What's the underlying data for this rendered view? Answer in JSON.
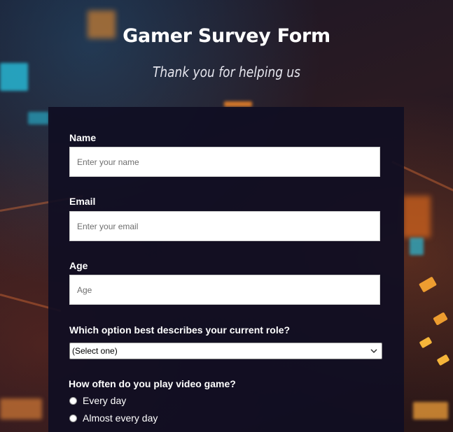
{
  "header": {
    "title": "Gamer Survey Form",
    "subtitle": "Thank you for helping us"
  },
  "form": {
    "name": {
      "label": "Name",
      "placeholder": "Enter your name",
      "value": ""
    },
    "email": {
      "label": "Email",
      "placeholder": "Enter your email",
      "value": ""
    },
    "age": {
      "label": "Age",
      "placeholder": "Age",
      "value": ""
    },
    "role": {
      "label": "Which option best describes your current role?",
      "selected": "(Select one)"
    },
    "frequency": {
      "label": "How often do you play video game?",
      "options": [
        "Every day",
        "Almost every day"
      ]
    }
  }
}
